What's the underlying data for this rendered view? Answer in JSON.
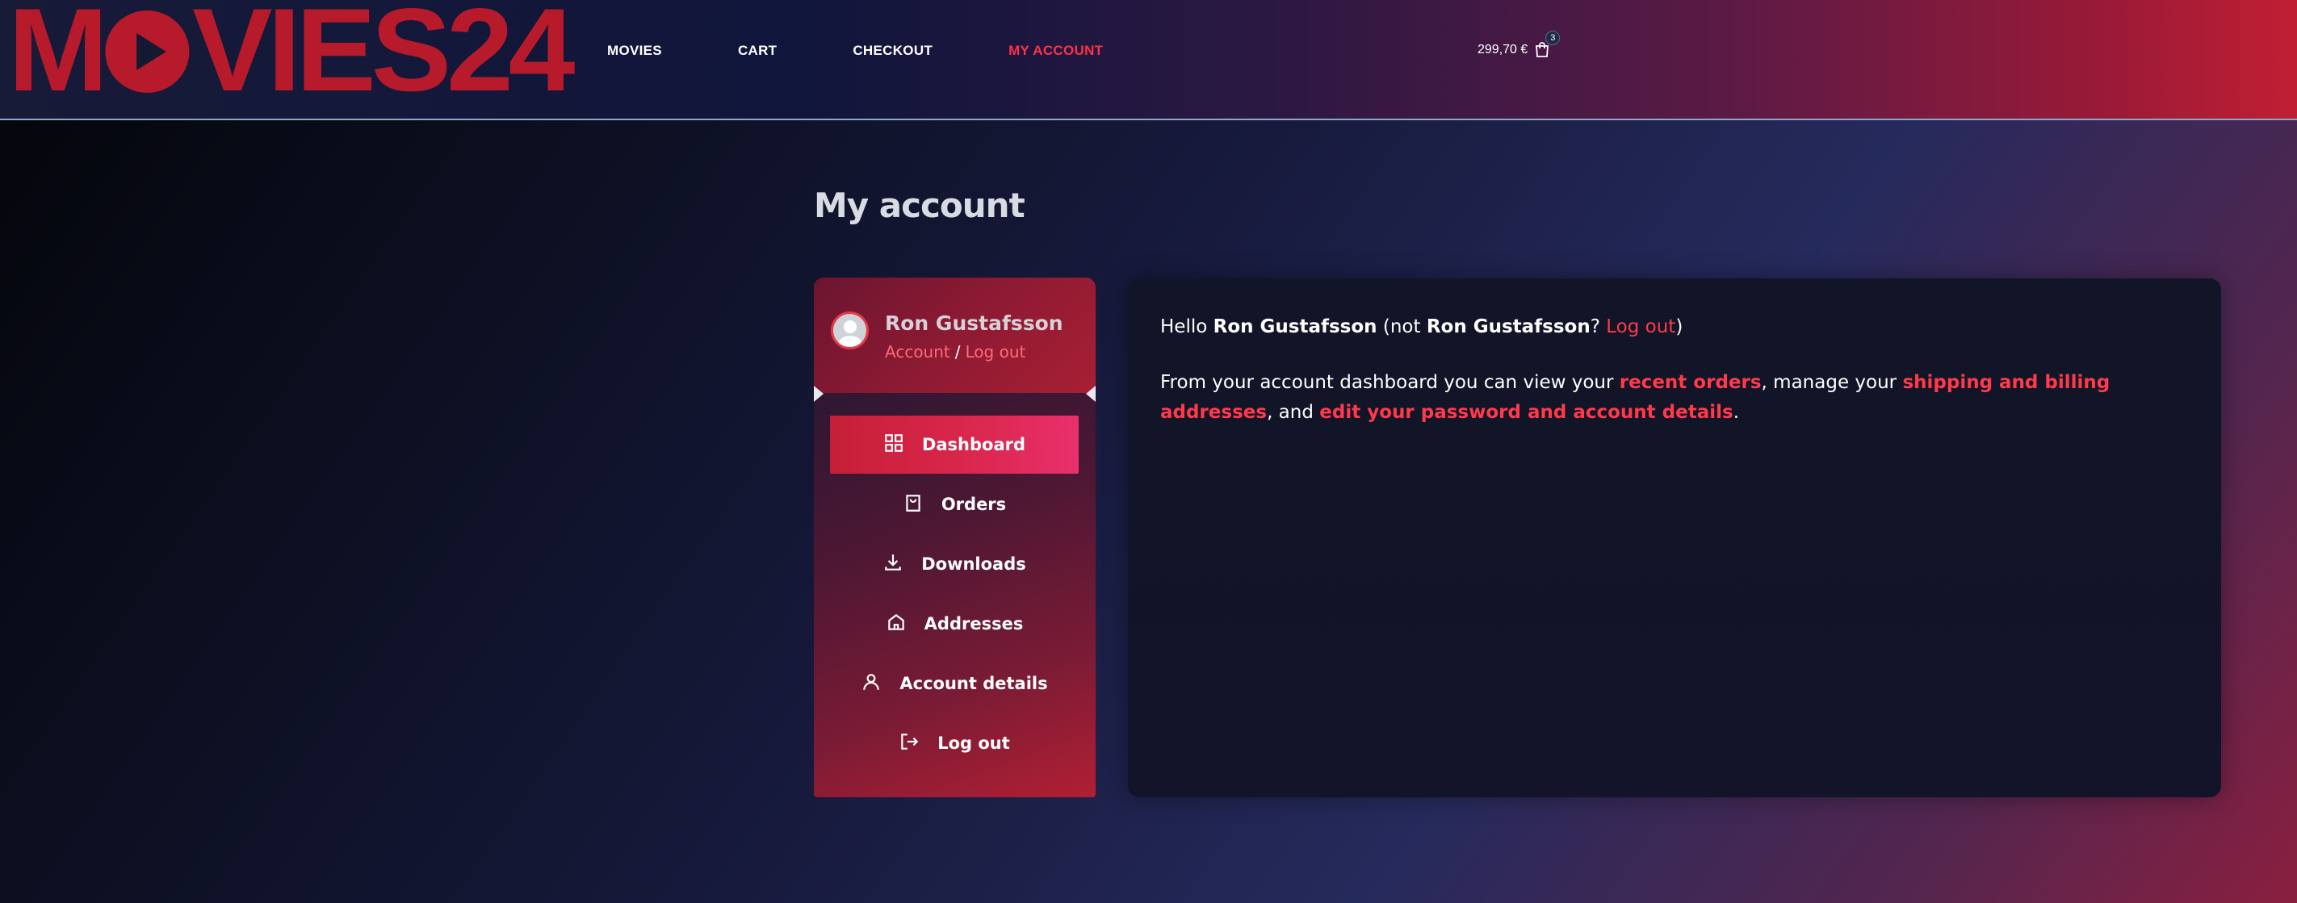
{
  "header": {
    "logo_left": "M",
    "logo_right": "VIES24",
    "nav": [
      "MOVIES",
      "CART",
      "CHECKOUT",
      "MY ACCOUNT"
    ],
    "active_nav": "MY ACCOUNT",
    "cart_total": "299,70 €",
    "cart_count": "3",
    "icons": {
      "cart": "shopping-bag-icon"
    }
  },
  "page": {
    "title": "My account"
  },
  "profile": {
    "name": "Ron Gustafsson",
    "account_link": "Account",
    "separator": "/",
    "logout_link": "Log out"
  },
  "menu": {
    "items": [
      {
        "label": "Dashboard",
        "icon": "grid-icon",
        "active": true
      },
      {
        "label": "Orders",
        "icon": "bag-icon",
        "active": false
      },
      {
        "label": "Downloads",
        "icon": "download-icon",
        "active": false
      },
      {
        "label": "Addresses",
        "icon": "home-icon",
        "active": false
      },
      {
        "label": "Account details",
        "icon": "user-icon",
        "active": false
      },
      {
        "label": "Log out",
        "icon": "logout-icon",
        "active": false
      }
    ]
  },
  "dashboard": {
    "hello": "Hello",
    "user": "Ron Gustafsson",
    "not_open": "(not",
    "not_user": "Ron Gustafsson",
    "question": "?",
    "logout": "Log out",
    "close_paren": ")",
    "intro": "From your account dashboard you can view your",
    "recent_orders": "recent orders",
    "manage": ", manage your",
    "addresses": "shipping and billing addresses",
    "and": ", and",
    "edit": "edit your password and account details",
    "period": "."
  },
  "colors": {
    "accent": "#ff3147",
    "logo": "#b71a2a",
    "link": "#ff3a4a"
  }
}
